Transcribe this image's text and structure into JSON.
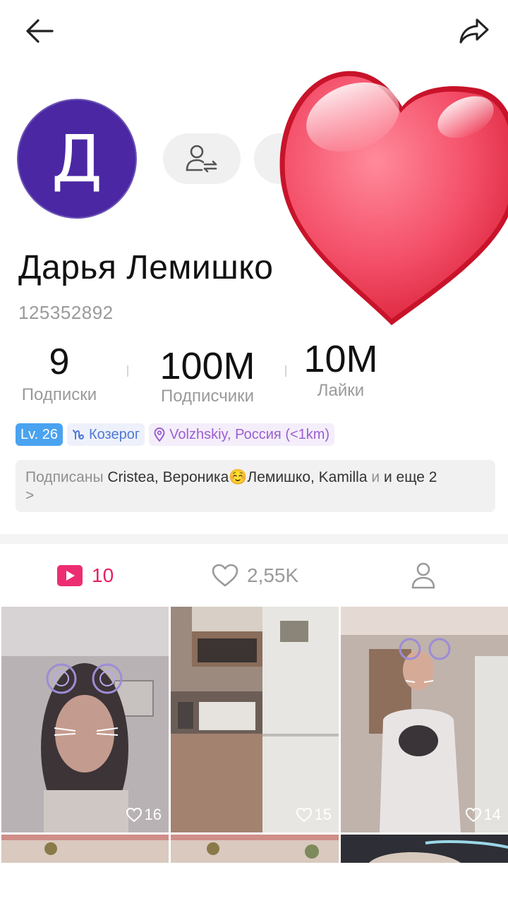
{
  "header": {
    "back_icon": "arrow-left-icon",
    "share_icon": "share-arrow-icon"
  },
  "profile": {
    "avatar_letter": "Д",
    "avatar_color": "#4b27a3",
    "name": "Дарья Лемишко",
    "user_id": "125352892"
  },
  "stats": [
    {
      "value": "9",
      "label": "Подписки"
    },
    {
      "value": "100M",
      "label": "Подписчики"
    },
    {
      "value": "10M",
      "label": "Лайки"
    }
  ],
  "tags": {
    "level": "Lv. 26",
    "zodiac": "Козерог",
    "location": "Volzhskiy, Россия (<1km)"
  },
  "followed_by": {
    "prefix": "Подписаны",
    "names": "Cristea, Вероника☺️Лемишко, Kamilla",
    "and": "и",
    "more": "и еще 2",
    "chevron": ">"
  },
  "tabs": {
    "videos_count": "10",
    "likes_count": "2,55K"
  },
  "videos": [
    {
      "likes": "16"
    },
    {
      "likes": "15"
    },
    {
      "likes": "14"
    }
  ],
  "colors": {
    "accent": "#e91e63",
    "level_tag": "#4aa3f0",
    "zodiac_tag": "#4f78d4",
    "location_tag": "#9b5fd1"
  }
}
